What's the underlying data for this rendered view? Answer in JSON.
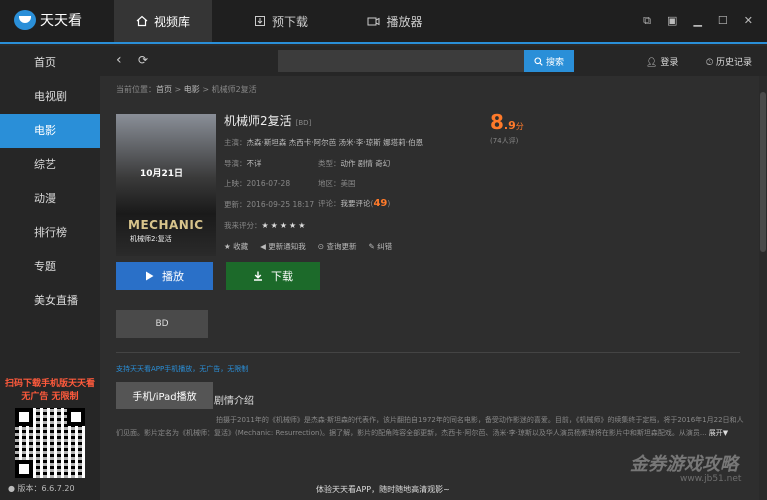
{
  "app": {
    "name": "天天看",
    "version": "版本：6.6.7.20"
  },
  "tabs": [
    {
      "label": "视频库",
      "icon": "home-icon",
      "active": true
    },
    {
      "label": "预下载",
      "icon": "download-icon",
      "active": false
    },
    {
      "label": "播放器",
      "icon": "video-player-icon",
      "active": false
    }
  ],
  "sidebar": {
    "items": [
      {
        "label": "首页"
      },
      {
        "label": "电视剧"
      },
      {
        "label": "电影",
        "active": true
      },
      {
        "label": "综艺"
      },
      {
        "label": "动漫"
      },
      {
        "label": "排行榜"
      },
      {
        "label": "专题"
      },
      {
        "label": "美女直播"
      }
    ],
    "promo_line1": "扫码下载手机版天天看",
    "promo_line2": "无广告  无限制"
  },
  "topbar": {
    "search_label": "搜索",
    "login_label": "登录",
    "history_label": "历史记录"
  },
  "breadcrumb": {
    "prefix": "当前位置：",
    "home": "首页",
    "sep1": " > ",
    "category": "电影",
    "sep2": " > ",
    "current": "机械师2复活"
  },
  "movie": {
    "title": "机械师2复活",
    "quality_tag": "[BD]",
    "poster_date": "10月21日",
    "poster_title": "MECHANIC",
    "poster_subtitle": "机械师2:复活",
    "cast_label": "主演：",
    "cast": "杰森·斯坦森  杰西卡·阿尔芭  汤米·李·琼斯  娜塔莉·伯恩",
    "director_label": "导演：",
    "director": "不详",
    "type_label": "类型：",
    "type": "动作  剧情  奇幻",
    "release_label": "上映：",
    "release": "2016-07-28",
    "region_label": "地区：",
    "region": "美国",
    "update_label": "更新：",
    "update": "2016-09-25 18:17",
    "comment_label": "评论：",
    "comment_action": "我要评论",
    "comment_count": "49",
    "my_rating_label": "我来评分：",
    "my_rating_stars": "★★★★★",
    "score_int": "8",
    "score_dec": ".9",
    "score_unit": "分",
    "votes": "(74人评)"
  },
  "actions": [
    {
      "label": "收藏",
      "icon": "star-icon"
    },
    {
      "label": "更新通知我",
      "icon": "speaker-icon"
    },
    {
      "label": "查询更新",
      "icon": "search-icon"
    },
    {
      "label": "纠错",
      "icon": "wrench-icon"
    }
  ],
  "buttons": {
    "play": "播放",
    "download": "下载",
    "source": "BD",
    "ipad": "手机/iPad播放"
  },
  "app_note": "支持天天看APP手机播放，无广告，无限制",
  "intro": {
    "heading": "剧情介绍",
    "text": "拍摄于2011年的《机械师》是杰森·斯坦森的代表作，该片翻拍自1972年的同名电影，备受动作影迷的喜爱。目前，《机械师》的续集终于定档，将于2016年1月22日和人们见面。影片定名为《机械师：复活》(Mechanic: Resurrection)。据了解，影片的配角阵容全部更新，杰西卡·阿尔芭、汤米·李·琼斯以及华人演员杨紫琼将在影片中和斯坦森配戏。从演员...",
    "more": "展开▼"
  },
  "bottom_note": "体验天天看APP，随时随地高清观影~",
  "watermark": {
    "line1": "金券游戏攻略",
    "line2": "www.jb51.net"
  }
}
